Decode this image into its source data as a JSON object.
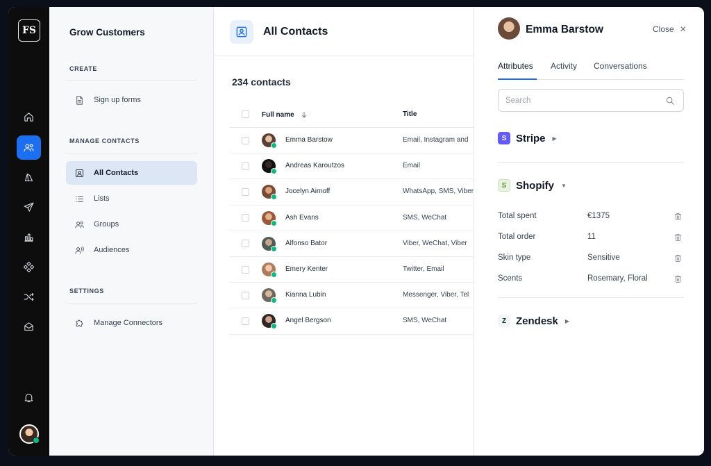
{
  "rail": {
    "logo_text": "FS",
    "icons": [
      "home-icon",
      "contacts-icon",
      "catalog-icon",
      "send-icon",
      "analytics-icon",
      "integrations-icon",
      "flows-icon",
      "inbox-icon",
      "bell-icon"
    ],
    "active": "contacts-icon"
  },
  "nav": {
    "title": "Grow Customers",
    "create_label": "CREATE",
    "signup_forms": "Sign up forms",
    "manage_label": "MANAGE CONTACTS",
    "all_contacts": "All Contacts",
    "lists": "Lists",
    "groups": "Groups",
    "audiences": "Audiences",
    "settings_label": "SETTINGS",
    "manage_connectors": "Manage Connectors"
  },
  "main": {
    "title": "All Contacts",
    "count": "234 contacts",
    "columns": [
      "Full name",
      "Title"
    ],
    "rows": [
      {
        "name": "Emma Barstow",
        "title": "Email, Instagram and"
      },
      {
        "name": "Andreas Karoutzos",
        "title": "Email"
      },
      {
        "name": "Jocelyn Aimoff",
        "title": "WhatsApp, SMS, Viber"
      },
      {
        "name": "Ash Evans",
        "title": "SMS, WeChat"
      },
      {
        "name": "Alfonso Bator",
        "title": "Viber, WeChat, Viber"
      },
      {
        "name": "Emery Kenter",
        "title": "Twitter, Email"
      },
      {
        "name": "Kianna Lubin",
        "title": "Messenger, Viber, Tel"
      },
      {
        "name": "Angel Bergson",
        "title": "SMS, WeChat"
      }
    ]
  },
  "panel": {
    "name": "Emma Barstow",
    "close_label": "Close",
    "tabs": [
      "Attributes",
      "Activity",
      "Conversations"
    ],
    "search_placeholder": "Search",
    "stripe": {
      "label": "Stripe",
      "logo": "S",
      "color": "#635bff"
    },
    "shopify": {
      "label": "Shopify",
      "logo": "S",
      "color": "#5e8e3e"
    },
    "zendesk": {
      "label": "Zendesk",
      "logo": "Z",
      "color": "#03363d"
    },
    "attributes": [
      {
        "key": "Total spent",
        "value": "€1375"
      },
      {
        "key": "Total order",
        "value": "11"
      },
      {
        "key": "Skin type",
        "value": "Sensitive"
      },
      {
        "key": "Scents",
        "value": "Rosemary, Floral"
      }
    ]
  }
}
